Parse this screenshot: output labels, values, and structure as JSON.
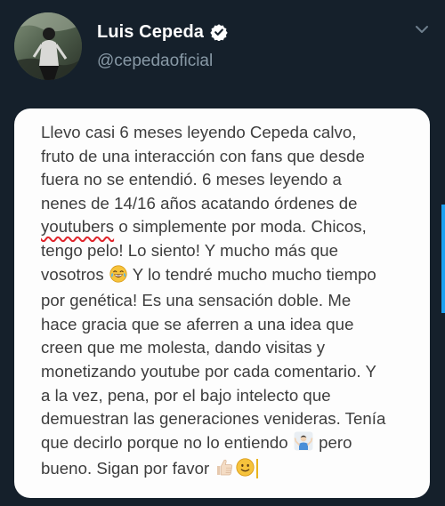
{
  "tweet": {
    "display_name": "Luis Cepeda",
    "handle": "@cepedaoficial",
    "verified": true,
    "menu_icon": "chevron-down-icon"
  },
  "note": {
    "lines": [
      {
        "text": "Llevo casi 6 meses leyendo Cepeda calvo,"
      },
      {
        "text": "fruto de una interacción con fans que desde"
      },
      {
        "text": "fuera no se entendió. 6 meses leyendo a"
      },
      {
        "text": "nenes de 14/16 años acatando órdenes de"
      },
      {
        "misspelled": "youtubers",
        "after": " o simplemente por moda. Chicos,"
      },
      {
        "text": "tengo pelo! Lo siento! Y mucho más que"
      },
      {
        "before": "vosotros ",
        "emoji": "laughing-tears-emoji",
        "after": " Y lo tendré mucho mucho tiempo"
      },
      {
        "text": "por genética! Es una sensación doble. Me"
      },
      {
        "text": "hace gracia que se aferren a una idea que"
      },
      {
        "text": "creen que me molesta, dando visitas y"
      },
      {
        "text": "monetizando youtube por cada comentario. Y"
      },
      {
        "text": "a la vez, pena, por el bajo intelecto que"
      },
      {
        "text": "demuestran las generaciones venideras. Tenía"
      },
      {
        "before": "que decirlo porque no lo entiendo ",
        "emoji": "person-shrugging-emoji",
        "after": " pero"
      },
      {
        "before": "bueno. Sigan por favor ",
        "emojis": [
          "thumbs-up-emoji",
          "slightly-smiling-face-emoji"
        ]
      }
    ]
  },
  "colors": {
    "background": "#15202b",
    "card": "#fdfdfd",
    "text": "#3d3d3d",
    "handle": "#8899a6",
    "accent": "#1da1f2",
    "spellcheck": "#e0242b",
    "cursor": "#e9b520"
  }
}
